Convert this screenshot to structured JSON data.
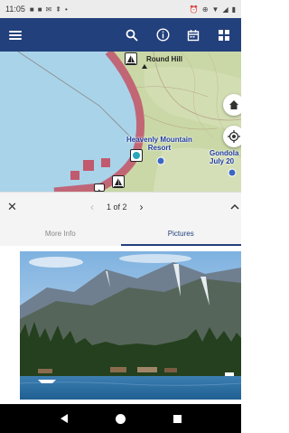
{
  "status_bar": {
    "time": "11:05",
    "left_icons": [
      "notification-icon",
      "notification-icon",
      "mail-icon",
      "navigation-icon",
      "dot-icon"
    ],
    "right_icons": [
      "alarm-icon",
      "vibrate-icon",
      "wifi-icon",
      "signal-icon",
      "battery-icon"
    ]
  },
  "app_bar": {
    "menu_icon": "hamburger-menu-icon",
    "actions": [
      "search-icon",
      "info-icon",
      "calendar-icon",
      "grid-icon"
    ],
    "background": "#22407c"
  },
  "map": {
    "labels": {
      "round_hill": "Round Hill",
      "heavenly_line1": "Heavenly Mountain",
      "heavenly_line2": "Resort",
      "gondola_line1": "Gondola",
      "gondola_line2": "July 20"
    },
    "colors": {
      "water": "#a9d3e8",
      "land": "#c9d8a6",
      "shore_route": "#c15a6e",
      "label_blue": "#1f3b9c"
    }
  },
  "pager": {
    "position": "1 of 2"
  },
  "tabs": {
    "items": [
      {
        "label": "More Info",
        "active": false
      },
      {
        "label": "Pictures",
        "active": true
      }
    ]
  }
}
